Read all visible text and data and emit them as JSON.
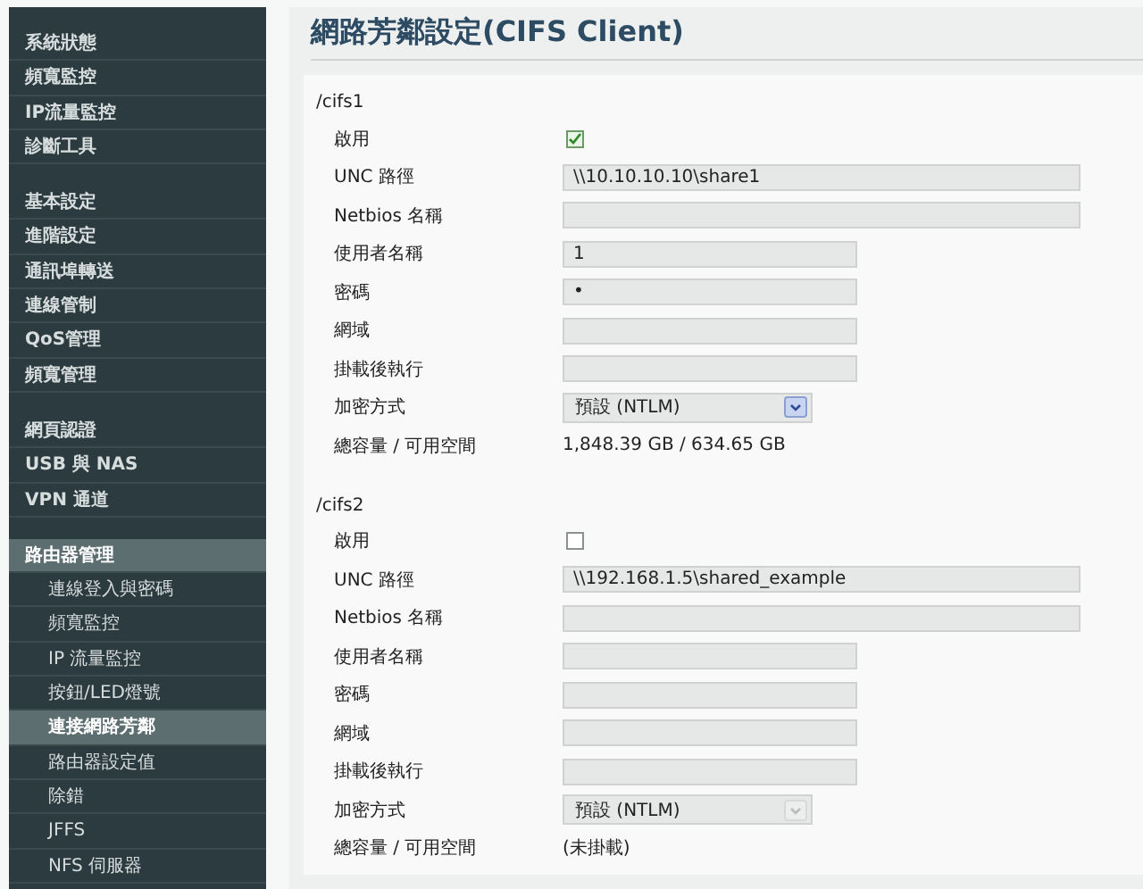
{
  "sidebar": {
    "groups": [
      {
        "items": [
          {
            "label": "系統狀態",
            "kind": "item",
            "selected": false
          },
          {
            "label": "頻寬監控",
            "kind": "item",
            "selected": false
          },
          {
            "label": "IP流量監控",
            "kind": "item",
            "selected": false
          },
          {
            "label": "診斷工具",
            "kind": "item",
            "selected": false
          }
        ]
      },
      {
        "items": [
          {
            "label": "基本設定",
            "kind": "item",
            "selected": false
          },
          {
            "label": "進階設定",
            "kind": "item",
            "selected": false
          },
          {
            "label": "通訊埠轉送",
            "kind": "item",
            "selected": false
          },
          {
            "label": "連線管制",
            "kind": "item",
            "selected": false
          },
          {
            "label": "QoS管理",
            "kind": "item",
            "selected": false
          },
          {
            "label": "頻寬管理",
            "kind": "item",
            "selected": false
          }
        ]
      },
      {
        "items": [
          {
            "label": "網頁認證",
            "kind": "item",
            "selected": false
          },
          {
            "label": "USB 與 NAS",
            "kind": "item",
            "selected": false
          },
          {
            "label": "VPN 通道",
            "kind": "item",
            "selected": false
          }
        ]
      },
      {
        "items": [
          {
            "label": "路由器管理",
            "kind": "item",
            "selected": true
          },
          {
            "label": "連線登入與密碼",
            "kind": "sub",
            "selected": false
          },
          {
            "label": "頻寬監控",
            "kind": "sub",
            "selected": false
          },
          {
            "label": "IP 流量監控",
            "kind": "sub",
            "selected": false
          },
          {
            "label": "按鈕/LED燈號",
            "kind": "sub",
            "selected": false
          },
          {
            "label": "連接網路芳鄰",
            "kind": "sub",
            "selected": true
          },
          {
            "label": "路由器設定值",
            "kind": "sub",
            "selected": false
          },
          {
            "label": "除錯",
            "kind": "sub",
            "selected": false
          },
          {
            "label": "JFFS",
            "kind": "sub",
            "selected": false
          },
          {
            "label": "NFS 伺服器",
            "kind": "sub",
            "selected": false
          }
        ]
      }
    ]
  },
  "page": {
    "title": "網路芳鄰設定(CIFS Client)",
    "sections": [
      {
        "path": "/cifs1",
        "fields": [
          {
            "label": "啟用",
            "kind": "checkbox",
            "checked": true
          },
          {
            "label": "UNC 路徑",
            "kind": "wide",
            "value": "\\\\10.10.10.10\\share1"
          },
          {
            "label": "Netbios 名稱",
            "kind": "wide"
          },
          {
            "label": "使用者名稱",
            "kind": "text",
            "value": "1"
          },
          {
            "label": "密碼",
            "kind": "text",
            "value": "•"
          },
          {
            "label": "網域",
            "kind": "text"
          },
          {
            "label": "掛載後執行",
            "kind": "text"
          },
          {
            "label": "加密方式",
            "kind": "select",
            "value": "預設 (NTLM)",
            "disabled": false
          },
          {
            "label": "總容量 / 可用空間",
            "kind": "info",
            "value": "1,848.39 GB / 634.65 GB"
          }
        ]
      },
      {
        "path": "/cifs2",
        "fields": [
          {
            "label": "啟用",
            "kind": "checkbox",
            "checked": false
          },
          {
            "label": "UNC 路徑",
            "kind": "wide",
            "value": "\\\\192.168.1.5\\shared_example"
          },
          {
            "label": "Netbios 名稱",
            "kind": "wide"
          },
          {
            "label": "使用者名稱",
            "kind": "text"
          },
          {
            "label": "密碼",
            "kind": "text"
          },
          {
            "label": "網域",
            "kind": "text"
          },
          {
            "label": "掛載後執行",
            "kind": "text"
          },
          {
            "label": "加密方式",
            "kind": "select",
            "value": "預設 (NTLM)",
            "disabled": true
          },
          {
            "label": "總容量 / 可用空間",
            "kind": "info",
            "value": "(未掛載)"
          }
        ]
      }
    ]
  }
}
